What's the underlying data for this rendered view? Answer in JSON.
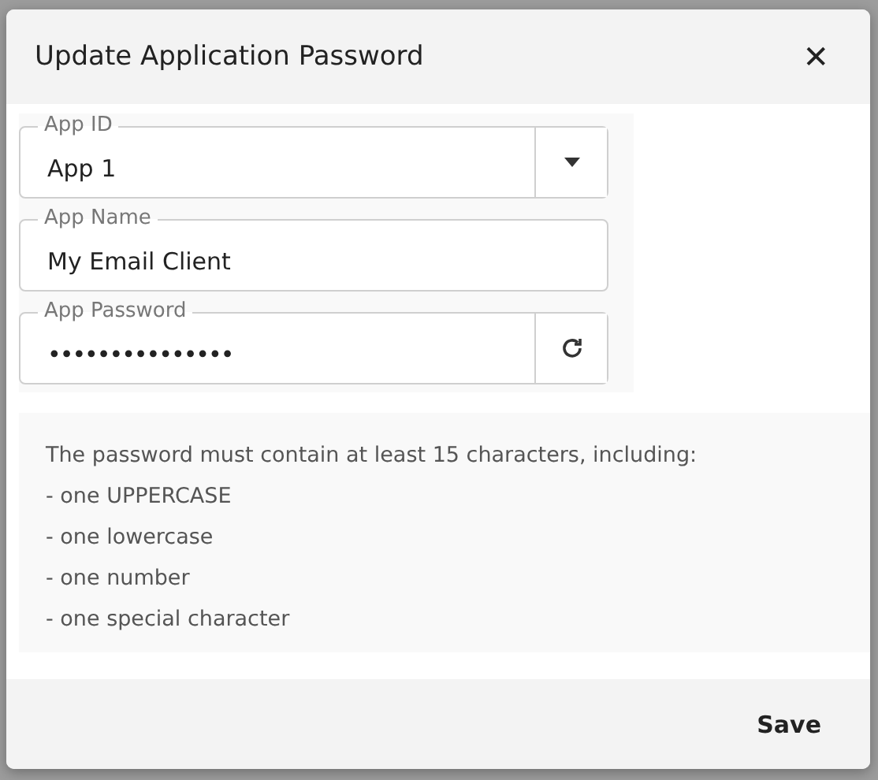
{
  "dialog": {
    "title": "Update Application Password",
    "close_icon": "✕"
  },
  "fields": [
    {
      "kind": "select",
      "label": "App ID",
      "value": "App 1"
    },
    {
      "kind": "text",
      "label": "App Name",
      "value": "My Email Client"
    },
    {
      "kind": "password",
      "label": "App Password",
      "value": "•••••••••••••••"
    }
  ],
  "hint": [
    "The password must contain at least 15 characters, including:",
    "- one UPPERCASE",
    "- one lowercase",
    "- one number",
    "- one special character"
  ],
  "buttons": [
    "Save"
  ]
}
